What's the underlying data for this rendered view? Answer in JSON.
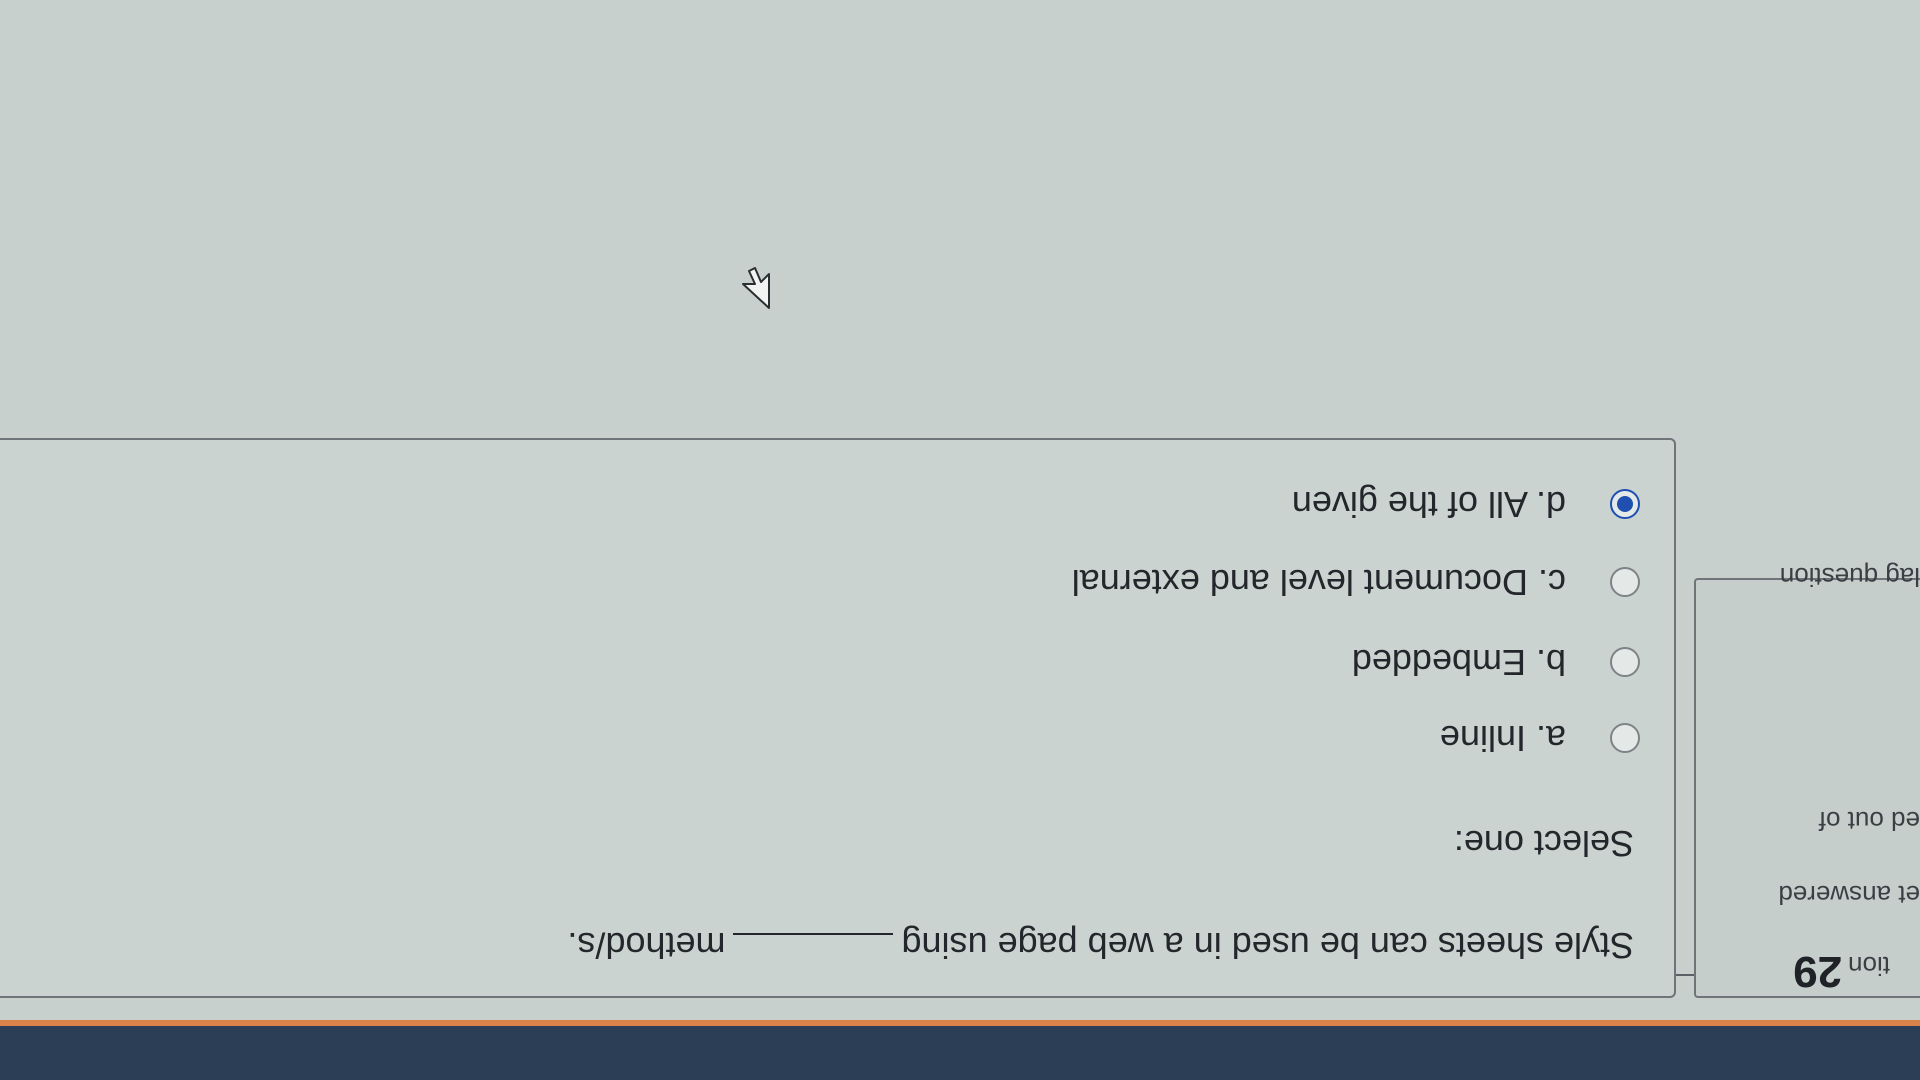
{
  "question_info": {
    "prefix": "tion",
    "number": "29",
    "status": "et answered",
    "marks": "ed out of",
    "flag_label": "lag question"
  },
  "question": {
    "text_before_blank": "Style sheets can be used in a web page using",
    "text_after_blank": "method/s.",
    "select_prompt": "Select one:",
    "options": [
      {
        "label": "a. Inline",
        "checked": false
      },
      {
        "label": "b. Embedded",
        "checked": false
      },
      {
        "label": "c. Document level and external",
        "checked": false
      },
      {
        "label": "d. All of the given",
        "checked": true
      }
    ]
  },
  "colors": {
    "navbar": "#2c3e55",
    "accent": "#d9824a",
    "radio_selected": "#1f4fb0"
  }
}
